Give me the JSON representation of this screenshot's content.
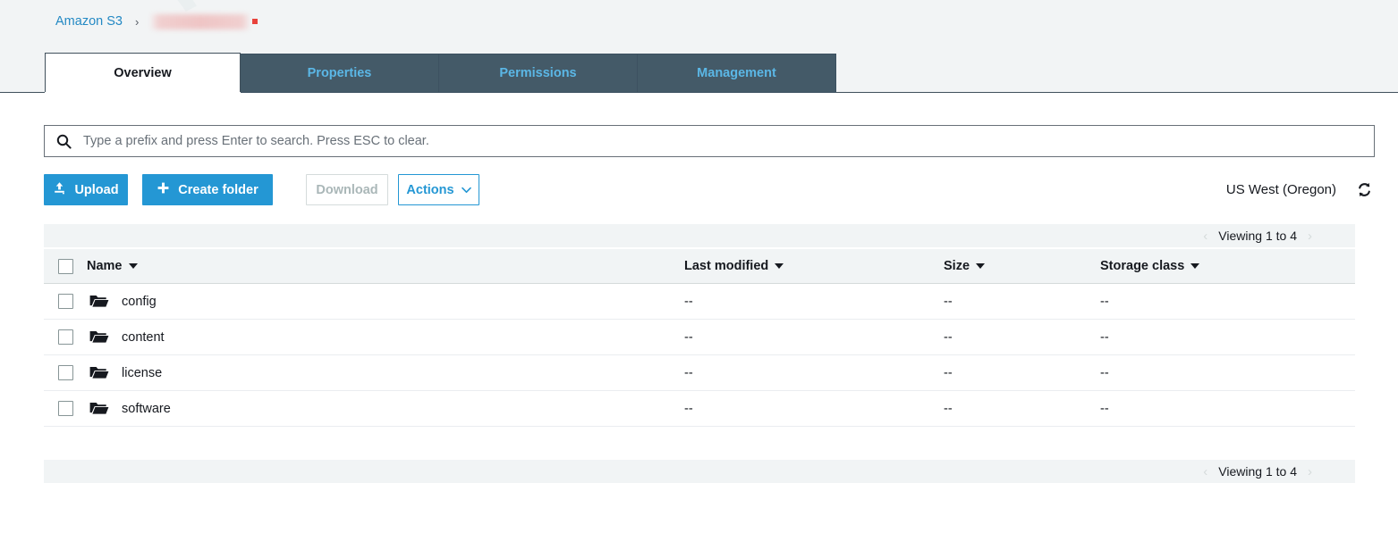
{
  "breadcrumb": {
    "root_label": "Amazon S3",
    "separator": "›",
    "bucket_label": "",
    "bucket_redacted": true
  },
  "tabs": [
    {
      "label": "Overview",
      "active": true
    },
    {
      "label": "Properties",
      "active": false
    },
    {
      "label": "Permissions",
      "active": false
    },
    {
      "label": "Management",
      "active": false
    }
  ],
  "search": {
    "placeholder": "Type a prefix and press Enter to search. Press ESC to clear.",
    "value": "",
    "icon": "search-icon"
  },
  "toolbar": {
    "upload_label": "Upload",
    "upload_icon": "upload-icon",
    "create_folder_label": "Create folder",
    "create_folder_icon": "plus-icon",
    "download_label": "Download",
    "download_disabled": true,
    "actions_label": "Actions",
    "actions_icon": "chevron-down-icon",
    "region_label": "US West (Oregon)",
    "refresh_icon": "refresh-icon"
  },
  "pagination": {
    "text": "Viewing 1 to 4",
    "prev_icon": "chevron-left-icon",
    "prev_glyph": "‹",
    "next_icon": "chevron-right-icon",
    "next_glyph": "›"
  },
  "table": {
    "columns": [
      {
        "key": "name",
        "label": "Name",
        "sortable": true
      },
      {
        "key": "mod",
        "label": "Last modified",
        "sortable": true
      },
      {
        "key": "size",
        "label": "Size",
        "sortable": true
      },
      {
        "key": "class",
        "label": "Storage class",
        "sortable": true
      }
    ],
    "rows": [
      {
        "name": "config",
        "icon": "folder-icon",
        "last_modified": "--",
        "size": "--",
        "storage_class": "--",
        "checked": false
      },
      {
        "name": "content",
        "icon": "folder-icon",
        "last_modified": "--",
        "size": "--",
        "storage_class": "--",
        "checked": false
      },
      {
        "name": "license",
        "icon": "folder-icon",
        "last_modified": "--",
        "size": "--",
        "storage_class": "--",
        "checked": false
      },
      {
        "name": "software",
        "icon": "folder-icon",
        "last_modified": "--",
        "size": "--",
        "storage_class": "--",
        "checked": false
      }
    ]
  },
  "colors": {
    "accent_blue": "#2497d4",
    "link_blue": "#2489c4",
    "tab_inactive_bg": "#445a68",
    "tab_inactive_text": "#5bb7e6",
    "band_bg": "#f2f4f5",
    "table_head_bg": "#f1f4f5",
    "redaction": "#eec2c2",
    "redaction_dot": "#e8413a"
  }
}
